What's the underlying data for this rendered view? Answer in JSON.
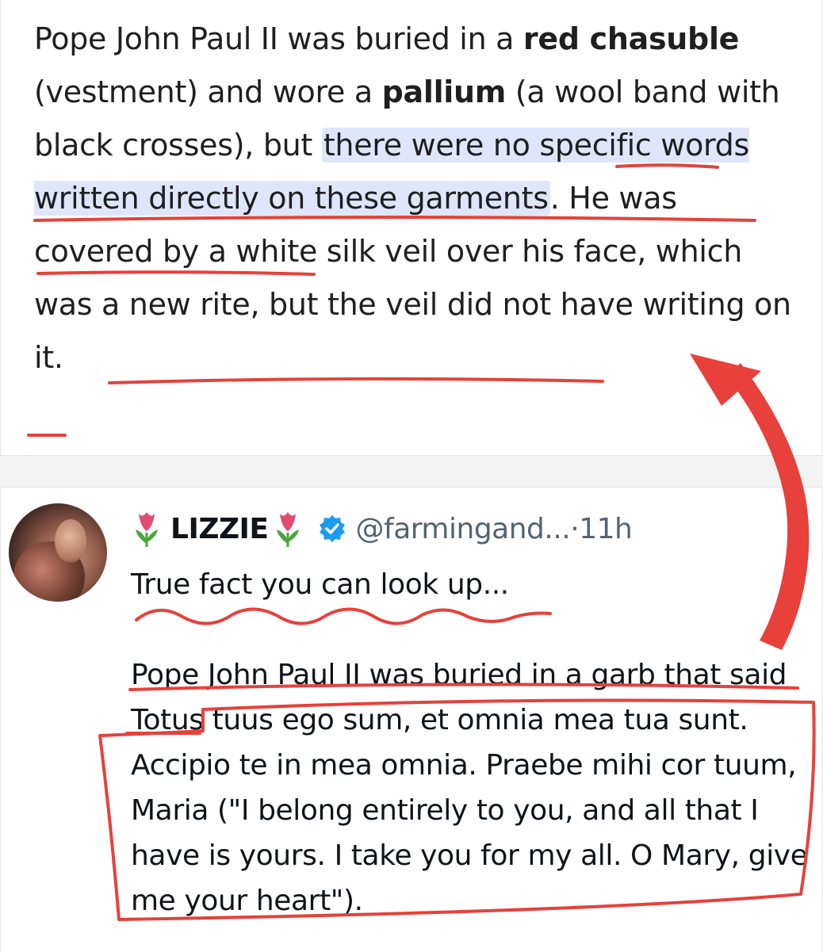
{
  "answer": {
    "p1": "Pope John Paul II was buried in a ",
    "b1": "red chasuble",
    "p2": " (vestment) and wore a ",
    "b2": "pallium",
    "p3": " (a wool band with black crosses), but ",
    "hl": "there were no specific words written directly on these garments",
    "p4": ". He was covered by a white silk veil over his face, which was a new rite, but the veil did not have writing on it."
  },
  "tweet": {
    "display_name": "LIZZIE",
    "handle": "@farmingand...",
    "dot": "·",
    "time": "11h",
    "line1": "True fact you can look up...",
    "line2": "Pope John Paul II was buried in a garb that said Totus tuus ego sum, et omnia mea tua sunt. Accipio te in mea omnia. Praebe mihi cor tuum, Maria (\"I belong entirely to you, and all that I have is yours. I take you for my all. O Mary, give me your heart\")."
  },
  "colors": {
    "highlight": "#dfe6fc",
    "annotation_red": "#e8403a",
    "verified": "#1d9bf0",
    "tulip_pink": "#e24a6f",
    "tulip_green": "#4aa33b"
  },
  "icons": [
    "tulip-emoji-icon",
    "verified-badge-icon",
    "avatar",
    "red-arrow-annotation"
  ]
}
